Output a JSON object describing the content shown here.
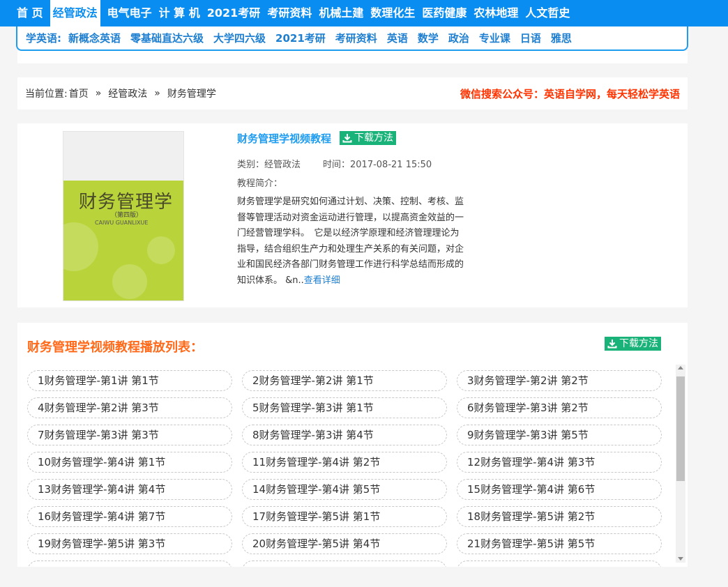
{
  "topnav": {
    "items": [
      "首 页",
      "经管政法",
      "电气电子",
      "计 算 机",
      "2021考研",
      "考研资料",
      "机械土建",
      "数理化生",
      "医药健康",
      "农林地理",
      "人文哲史"
    ],
    "active_index": 1
  },
  "subnav": {
    "label": "学英语:",
    "links": [
      "新概念英语",
      "零基础直达六级",
      "大学四六级",
      "2021考研",
      "考研资料",
      "英语",
      "数学",
      "政治",
      "专业课",
      "日语",
      "雅思"
    ]
  },
  "breadcrumb": {
    "prefix": "当前位置:",
    "items": [
      "首页",
      "经管政法",
      "财务管理学"
    ],
    "separator": "»"
  },
  "promo": "微信搜索公众号：英语自学网，每天轻松学英语",
  "book": {
    "title": "财务管理学视频教程",
    "download_label": "下载方法",
    "category": "类别：经管政法",
    "time": "时间：2017-08-21 15:50",
    "intro_label": "教程简介：",
    "description": "财务管理学是研究如何通过计划、决策、控制、考核、监督等管理活动对资金运动进行管理，以提高资金效益的一门经营管理学科。　它是以经济学原理和经济管理理论为指导，结合组织生产力和处理生产关系的有关问题，对企业和国民经济各部门财务管理工作进行科学总结而形成的知识体系。 &n..",
    "more_label": "查看详细",
    "cover": {
      "title": "财务管理学",
      "edition": "（第四版）",
      "pinyin": "CAIWU GUANLIXUE"
    }
  },
  "playlist": {
    "title": "财务管理学视频教程播放列表：",
    "download_label": "下载方法",
    "episodes": [
      "1财务管理学-第1讲 第1节",
      "2财务管理学-第2讲 第1节",
      "3财务管理学-第2讲 第2节",
      "4财务管理学-第2讲 第3节",
      "5财务管理学-第3讲 第1节",
      "6财务管理学-第3讲 第2节",
      "7财务管理学-第3讲 第3节",
      "8财务管理学-第3讲 第4节",
      "9财务管理学-第3讲 第5节",
      "10财务管理学-第4讲 第1节",
      "11财务管理学-第4讲 第2节",
      "12财务管理学-第4讲 第3节",
      "13财务管理学-第4讲 第4节",
      "14财务管理学-第4讲 第5节",
      "15财务管理学-第4讲 第6节",
      "16财务管理学-第4讲 第7节",
      "17财务管理学-第5讲 第1节",
      "18财务管理学-第5讲 第2节",
      "19财务管理学-第5讲 第3节",
      "20财务管理学-第5讲 第4节",
      "21财务管理学-第5讲 第5节"
    ]
  },
  "colors": {
    "nav_blue": "#0a8df0",
    "link_blue": "#1e7fd0",
    "title_blue": "#1e9cf0",
    "promo_red": "#ff3300",
    "playlist_orange": "#ff6a1a",
    "download_green": "#19b37a"
  },
  "icons": {
    "download": "download-icon",
    "scroll_up": "scroll-up-arrow-icon",
    "scroll_down": "scroll-down-arrow-icon"
  }
}
